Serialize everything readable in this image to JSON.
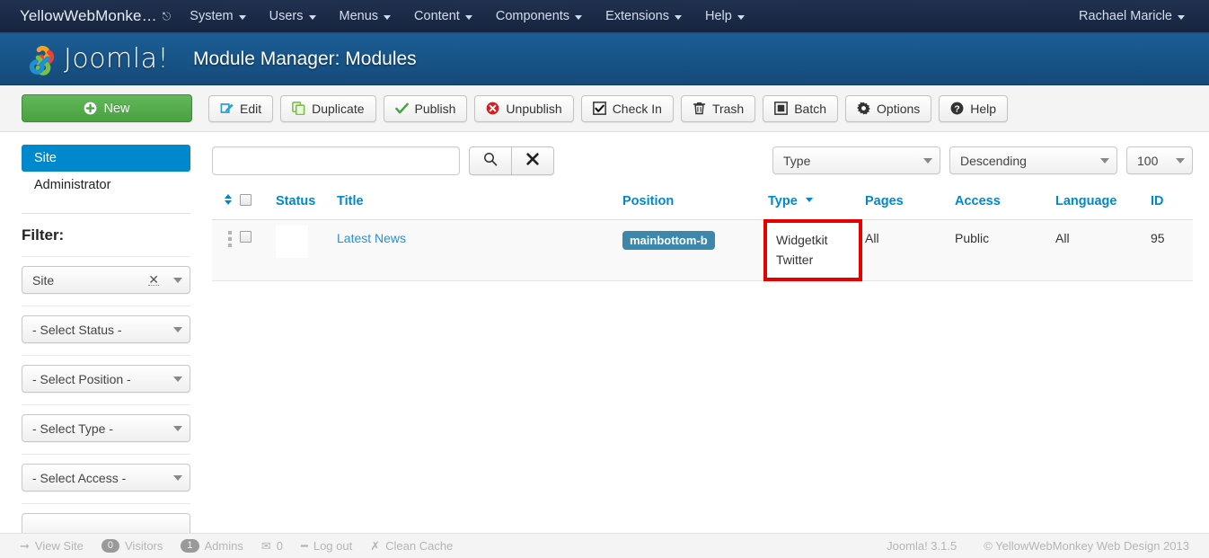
{
  "topnav": {
    "brand": "YellowWebMonke…",
    "brand_icon": "external-link-icon",
    "items": [
      {
        "label": "System"
      },
      {
        "label": "Users"
      },
      {
        "label": "Menus"
      },
      {
        "label": "Content"
      },
      {
        "label": "Components"
      },
      {
        "label": "Extensions"
      },
      {
        "label": "Help"
      }
    ],
    "user": "Rachael Maricle"
  },
  "header": {
    "logo_text": "Joomla!",
    "page_title": "Module Manager: Modules"
  },
  "toolbar": {
    "buttons": [
      {
        "label": "New",
        "icon": "plus-circle-icon"
      },
      {
        "label": "Edit",
        "icon": "pencil-square-icon"
      },
      {
        "label": "Duplicate",
        "icon": "copy-icon"
      },
      {
        "label": "Publish",
        "icon": "check-icon"
      },
      {
        "label": "Unpublish",
        "icon": "x-circle-icon"
      },
      {
        "label": "Check In",
        "icon": "checkbox-checked-icon"
      },
      {
        "label": "Trash",
        "icon": "trash-icon"
      },
      {
        "label": "Batch",
        "icon": "square-icon"
      },
      {
        "label": "Options",
        "icon": "gear-icon"
      },
      {
        "label": "Help",
        "icon": "question-circle-icon"
      }
    ]
  },
  "sidebar": {
    "nav": [
      {
        "label": "Site",
        "active": true
      },
      {
        "label": "Administrator",
        "active": false
      }
    ],
    "filter_label": "Filter:",
    "selects": [
      {
        "name": "client-filter",
        "value": "Site",
        "clearable": true
      },
      {
        "name": "status-filter",
        "value": "- Select Status -",
        "clearable": false
      },
      {
        "name": "position-filter",
        "value": "- Select Position -",
        "clearable": false
      },
      {
        "name": "type-filter",
        "value": "- Select Type -",
        "clearable": false
      },
      {
        "name": "access-filter",
        "value": "- Select Access -",
        "clearable": false
      }
    ]
  },
  "search": {
    "value": "",
    "placeholder": "",
    "go_icon": "search-icon",
    "clear_icon": "close-icon"
  },
  "right_filters": {
    "sort_field": "Type",
    "sort_direction": "Descending",
    "limit": "100"
  },
  "table": {
    "columns": [
      "Status",
      "Title",
      "Position",
      "Type",
      "Pages",
      "Access",
      "Language",
      "ID"
    ],
    "sorted_column": "Type",
    "rows": [
      {
        "title": "Latest News",
        "position": "mainbottom-b",
        "type": "Widgetkit Twitter",
        "type_line1": "Widgetkit",
        "type_line2": "Twitter",
        "pages": "All",
        "access": "Public",
        "language": "All",
        "id": "95",
        "highlighted_cell": "type"
      }
    ]
  },
  "footer": {
    "view_site": "View Site",
    "visitors_count": "0",
    "visitors": "Visitors",
    "admins_count": "1",
    "admins": "Admins",
    "messages": "0",
    "logout": "Log out",
    "clean_cache": "Clean Cache",
    "version": "Joomla! 3.1.5",
    "copyright": "© YellowWebMonkey Web Design 2013"
  },
  "colors": {
    "topnav_bg": "#1b2a49",
    "header_bg": "#1b5e96",
    "accent_blue": "#0088cc",
    "link_blue": "#2a8fd4",
    "new_green": "#4aa141",
    "badge_teal": "#3b88ab",
    "highlight_red": "#e60000"
  }
}
